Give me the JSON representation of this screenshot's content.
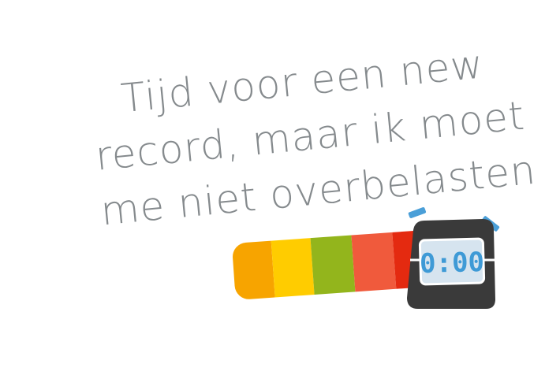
{
  "headline": {
    "lines": [
      "Tijd voor een new",
      "record, maar ik moet",
      "me niet overbelasten"
    ],
    "color": "#858a8d"
  },
  "effort_bar": {
    "segments": [
      {
        "name": "orange",
        "color": "#f7a400"
      },
      {
        "name": "yellow",
        "color": "#ffcc00"
      },
      {
        "name": "green",
        "color": "#93b51c"
      },
      {
        "name": "coral",
        "color": "#f05a3c"
      },
      {
        "name": "red",
        "color": "#e42a10"
      }
    ]
  },
  "stopwatch": {
    "display": "0:00",
    "body_color": "#3a3a3a",
    "screen_color": "#d6e4ef",
    "digit_color": "#3e9ad6",
    "button_color": "#4a9fd8",
    "icon": "stopwatch-icon"
  }
}
